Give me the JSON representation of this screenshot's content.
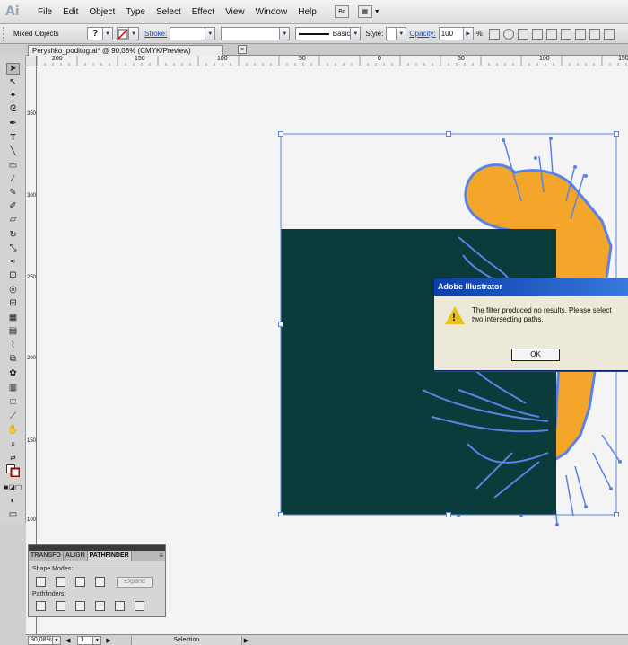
{
  "app": {
    "logo": "Ai"
  },
  "menu": [
    "File",
    "Edit",
    "Object",
    "Type",
    "Select",
    "Effect",
    "View",
    "Window",
    "Help"
  ],
  "menubar_buttons": {
    "bridge": "Br",
    "arrange": "▦"
  },
  "control": {
    "selection_label": "Mixed Objects",
    "fill_value": "?",
    "stroke_label": "Stroke:",
    "brush_label": "Basic",
    "style_label": "Style:",
    "opacity_label": "Opacity:",
    "opacity_value": "100",
    "percent": "%"
  },
  "document": {
    "tab_title": "Peryshko_poditog.ai* @ 90,08% (CMYK/Preview)",
    "close_glyph": "×"
  },
  "rulers": {
    "horizontal": [
      "200",
      "150",
      "100",
      "50",
      "0",
      "50",
      "100",
      "150"
    ],
    "vertical": [
      "350",
      "300",
      "250",
      "200",
      "150",
      "100"
    ]
  },
  "dialog": {
    "title": "Adobe Illustrator",
    "message": "The filter produced no results. Please select two intersecting paths.",
    "ok_label": "OK",
    "warning_mark": "!"
  },
  "pathfinder": {
    "tabs": [
      "TRANSFO",
      "ALIGN",
      "PATHFINDER"
    ],
    "active_tab": "PATHFINDER",
    "shape_modes_label": "Shape Modes:",
    "pathfinders_label": "Pathfinders:",
    "expand_label": "Expand"
  },
  "status": {
    "zoom": "90,08%",
    "page": "1",
    "mode": "Selection"
  },
  "colors": {
    "dark_square": "#0b3b3b",
    "orange_shape": "#f4a62a",
    "selection_blue": "#5a82e6",
    "dialog_title": "#0a3ea8"
  }
}
